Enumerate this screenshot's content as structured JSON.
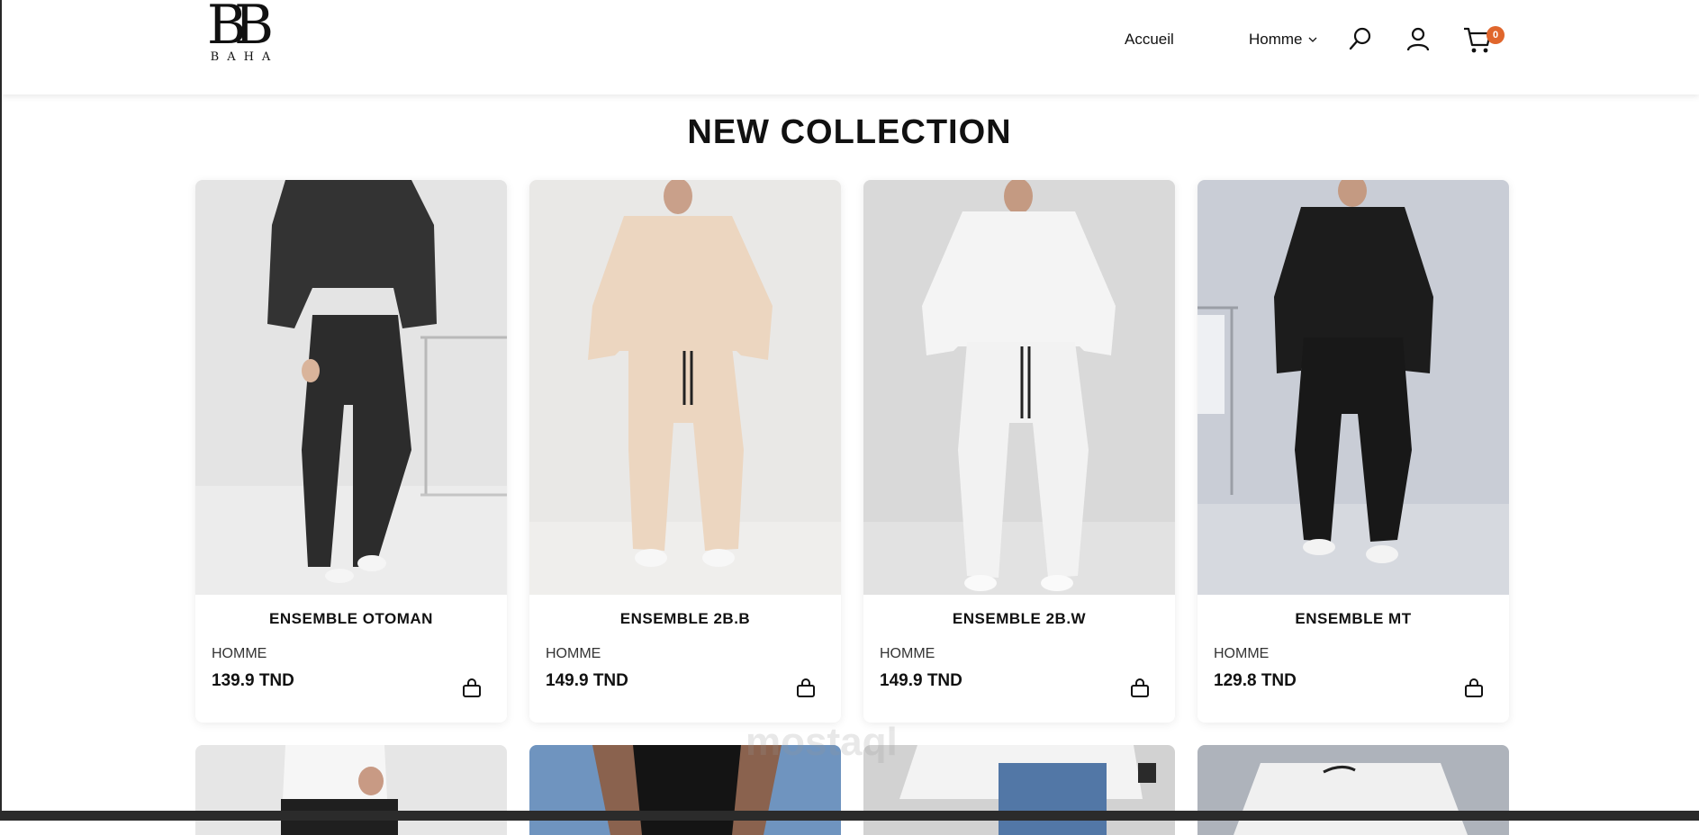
{
  "brand": {
    "logo_mark": "BB",
    "logo_text": "BAHA"
  },
  "nav": {
    "home_label": "Accueil",
    "homme_label": "Homme",
    "cart_count": "0"
  },
  "section": {
    "title": "NEW COLLECTION"
  },
  "products": [
    {
      "name": "ENSEMBLE OTOMAN",
      "category": "HOMME",
      "price": "139.9 TND"
    },
    {
      "name": "ENSEMBLE 2B.B",
      "category": "HOMME",
      "price": "149.9 TND"
    },
    {
      "name": "ENSEMBLE 2B.W",
      "category": "HOMME",
      "price": "149.9 TND"
    },
    {
      "name": "ENSEMBLE MT",
      "category": "HOMME",
      "price": "129.8 TND"
    }
  ],
  "watermark": "mostaql",
  "colors": {
    "badge": "#e0662c",
    "text": "#111111"
  }
}
